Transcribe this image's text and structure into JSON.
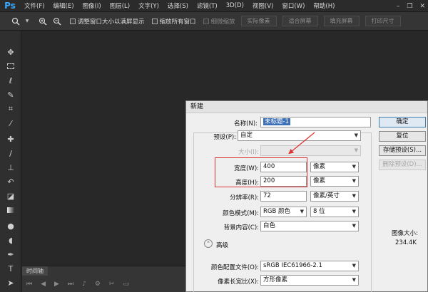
{
  "app": {
    "logo": "Ps"
  },
  "menu": [
    "文件(F)",
    "编辑(E)",
    "图像(I)",
    "图层(L)",
    "文字(Y)",
    "选择(S)",
    "滤镜(T)",
    "3D(D)",
    "视图(V)",
    "窗口(W)",
    "帮助(H)"
  ],
  "window_controls": {
    "minimize": "–",
    "restore": "❐",
    "close": "✕"
  },
  "options_bar": {
    "resize_windows_label": "调整窗口大小以满屏显示",
    "zoom_all_label": "缩放所有窗口",
    "scrubby_zoom_label": "细微缩放",
    "actual_pixels_label": "实际像素",
    "fit_screen_label": "适合屏幕",
    "fill_screen_label": "填充屏幕",
    "print_size_label": "打印尺寸"
  },
  "timeline": {
    "tab_label": "时间轴"
  },
  "dialog": {
    "title": "新建",
    "name_label": "名称(N):",
    "name_value": "未标题-1",
    "preset_label": "预设(P):",
    "preset_value": "自定",
    "size_label": "大小(I):",
    "width_label": "宽度(W):",
    "width_value": "400",
    "width_unit": "像素",
    "height_label": "高度(H):",
    "height_value": "200",
    "height_unit": "像素",
    "resolution_label": "分辨率(R):",
    "resolution_value": "72",
    "resolution_unit": "像素/英寸",
    "color_mode_label": "颜色模式(M):",
    "color_mode_value": "RGB 颜色",
    "bit_depth_value": "8 位",
    "background_label": "背景内容(C):",
    "background_value": "白色",
    "advanced_label": "高级",
    "color_profile_label": "颜色配置文件(O):",
    "color_profile_value": "sRGB IEC61966-2.1",
    "pixel_aspect_label": "像素长宽比(X):",
    "pixel_aspect_value": "方形像素",
    "ok_label": "确定",
    "reset_label": "复位",
    "save_preset_label": "存储预设(S)...",
    "delete_preset_label": "删除预设(D)...",
    "image_size_label": "图像大小:",
    "image_size_value": "234.4K"
  }
}
